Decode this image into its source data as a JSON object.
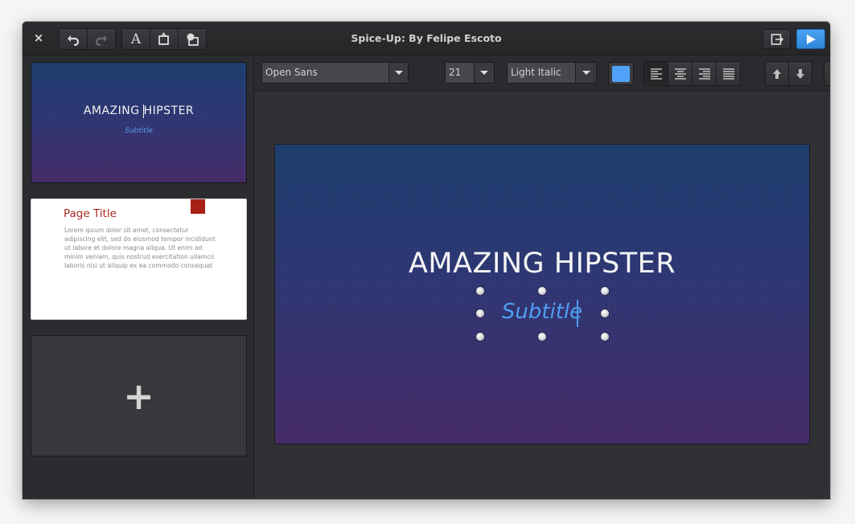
{
  "window": {
    "title": "Spice-Up: By Felipe Escoto"
  },
  "titlebar": {
    "close_glyph": "×",
    "undo_icon": "undo-icon",
    "redo_icon": "redo-icon",
    "add_text_glyph": "A",
    "add_shape_icon": "add-shape-icon",
    "add_image_icon": "add-image-icon",
    "export_icon": "export-icon",
    "present_icon": "play-icon"
  },
  "toolbar": {
    "font_family": "Open Sans",
    "font_size": "21",
    "font_style": "Light Italic",
    "text_color": "#4fa2f7"
  },
  "slides": [
    {
      "title": "AMAZING HIPSTER",
      "subtitle": "Subtitle"
    },
    {
      "title": "Page Title",
      "body": "Lorem ipsum dolor sit amet, consectetur adipiscing elit, sed do eiusmod tempor incididunt ut labore et dolore magna aliqua. Ut enim ad minim veniam, quis nostrud exercitation ullamco laboris nisi ut aliquip ex ea commodo consequat"
    }
  ],
  "add_slide": {
    "glyph": "+"
  },
  "canvas": {
    "title": "AMAZING HIPSTER",
    "subtitle": "Subtitle"
  },
  "colors": {
    "accent": "#3689e6",
    "slide_gradient_top": "#1b3d6e",
    "slide_gradient_bottom": "#452a69",
    "subtitle": "#4f9ef0",
    "page_title": "#a8281f"
  }
}
